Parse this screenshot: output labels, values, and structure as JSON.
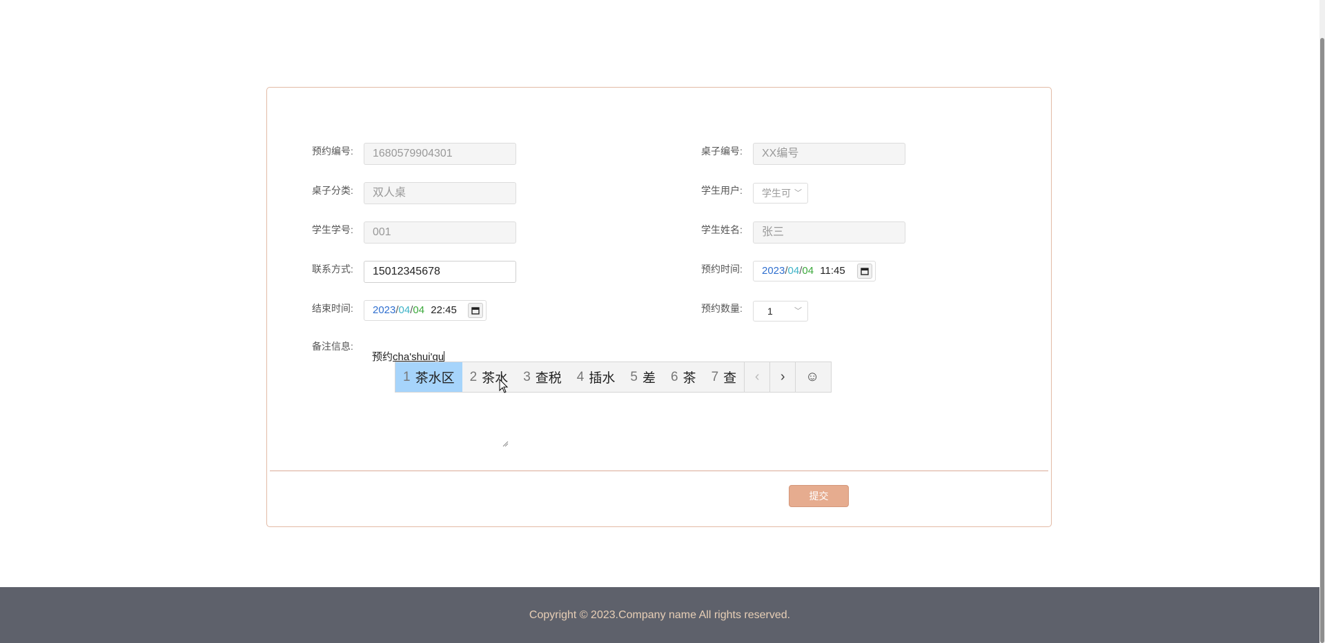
{
  "form": {
    "fields": {
      "booking_no": {
        "label": "预约编号:",
        "value": "1680579904301"
      },
      "table_no": {
        "label": "桌子编号:",
        "placeholder": "XX编号"
      },
      "table_category": {
        "label": "桌子分类:",
        "value": "双人桌"
      },
      "student_user": {
        "label": "学生用户:",
        "value": "学生可"
      },
      "student_id": {
        "label": "学生学号:",
        "value": "001"
      },
      "student_name": {
        "label": "学生姓名:",
        "value": "张三"
      },
      "contact": {
        "label": "联系方式:",
        "value": "15012345678"
      },
      "booking_time": {
        "label": "预约时间:",
        "year": "2023",
        "month": "04",
        "day": "04",
        "time": "11:45"
      },
      "end_time": {
        "label": "结束时间:",
        "year": "2023",
        "month": "04",
        "day": "04",
        "time": "22:45"
      },
      "booking_qty": {
        "label": "预约数量:",
        "value": "1"
      },
      "remarks": {
        "label": "备注信息:",
        "committed": "预约",
        "composing": "cha'shui'qu"
      }
    },
    "date_separator": "/",
    "submit_label": "提交"
  },
  "ime": {
    "candidates": [
      {
        "num": "1",
        "text": "茶水区",
        "selected": true
      },
      {
        "num": "2",
        "text": "茶水"
      },
      {
        "num": "3",
        "text": "查税"
      },
      {
        "num": "4",
        "text": "插水"
      },
      {
        "num": "5",
        "text": "差"
      },
      {
        "num": "6",
        "text": "茶"
      },
      {
        "num": "7",
        "text": "查"
      }
    ],
    "prev": "‹",
    "next": "›",
    "emoji": "☺"
  },
  "footer": {
    "copyright": "Copyright © 2023.Company name All rights reserved."
  }
}
